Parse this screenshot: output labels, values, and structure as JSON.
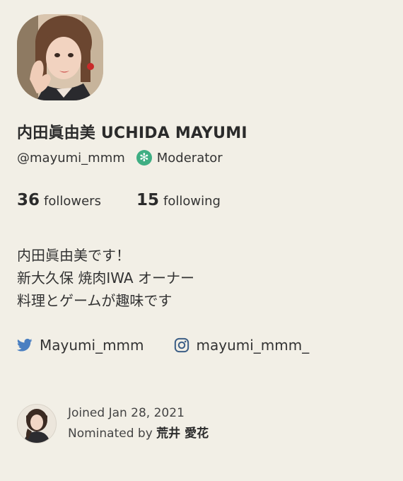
{
  "profile": {
    "name": "内田眞由美 UCHIDA MAYUMI",
    "handle": "@mayumi_mmm",
    "role": "Moderator",
    "role_icon": "✻"
  },
  "stats": {
    "followers_count": "36",
    "followers_label": "followers",
    "following_count": "15",
    "following_label": "following"
  },
  "bio": [
    "内田眞由美です！",
    "新大久保 焼肉IWA オーナー",
    "料理とゲームが趣味です"
  ],
  "social": {
    "twitter": "Mayumi_mmm",
    "instagram": "mayumi_mmm_"
  },
  "footer": {
    "joined": "Joined Jan 28, 2021",
    "nominated_prefix": "Nominated by",
    "nominated_by": "荒井 愛花"
  },
  "colors": {
    "background": "#f2efe6",
    "moderator_badge": "#3fae83",
    "twitter": "#4a7fc1",
    "instagram": "#3d5f86"
  },
  "icons": [
    "profile-photo",
    "moderator-badge-icon",
    "twitter-icon",
    "instagram-icon",
    "nominator-avatar"
  ]
}
